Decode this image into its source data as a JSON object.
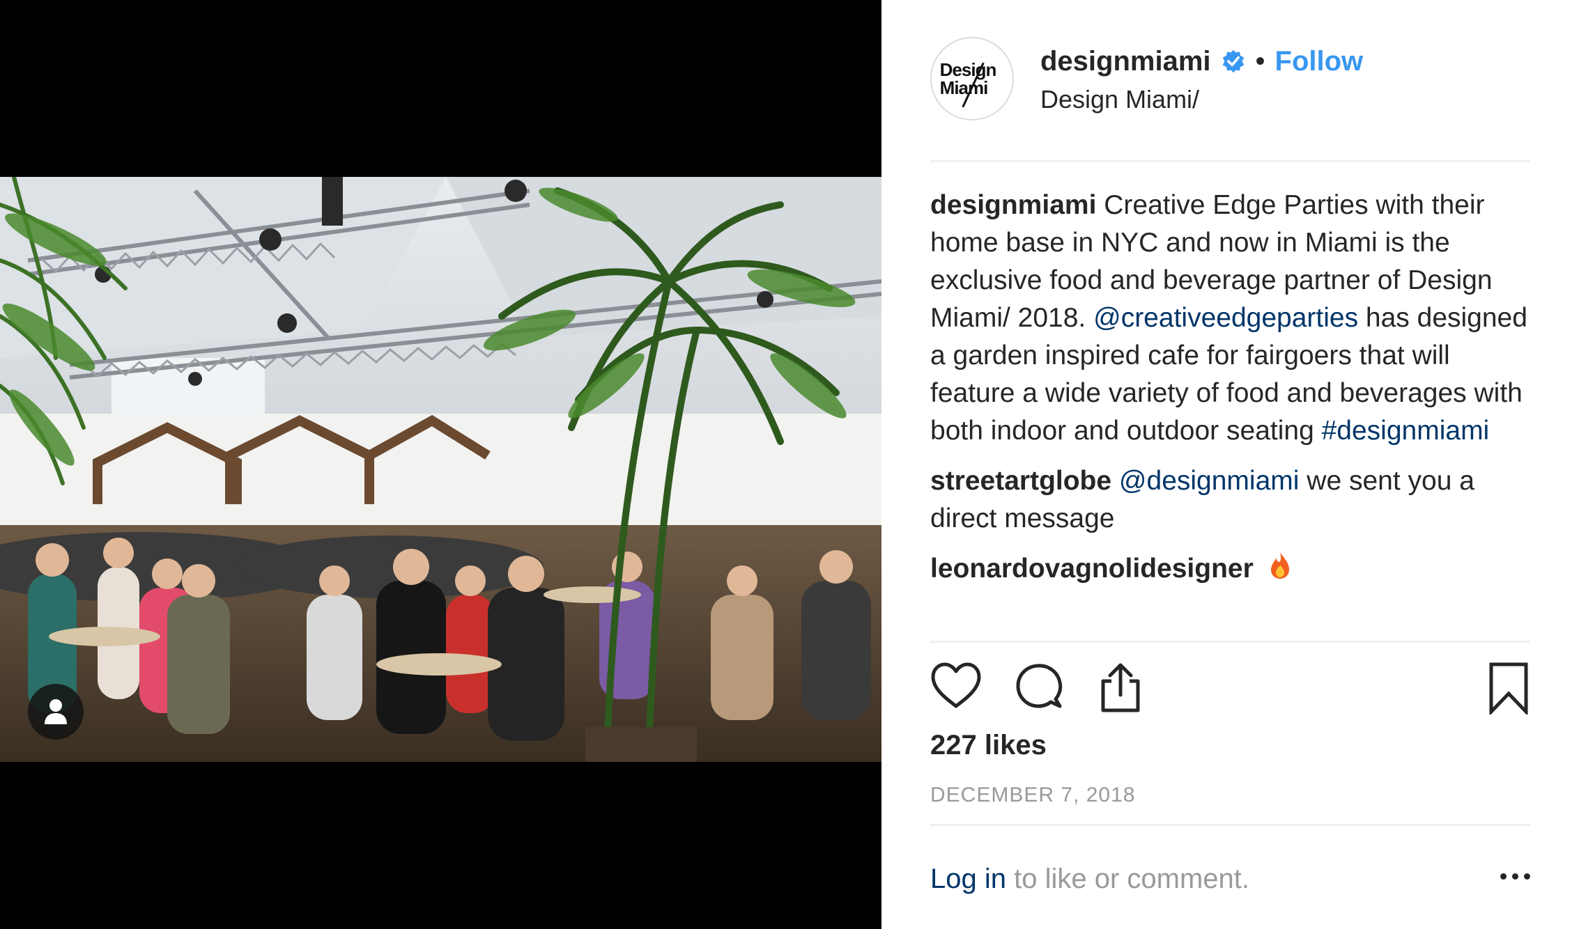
{
  "post": {
    "image_alt": "Creative Edge Parties garden inspired cafe at Design Miami/ 2018",
    "user_tag_icon": "person-icon"
  },
  "header": {
    "avatar_logo_line1": "Design",
    "avatar_logo_line2": "Miami",
    "username": "designmiami",
    "verified_icon": "verified-badge-icon",
    "separator": "•",
    "follow_label": "Follow",
    "subtitle": "Design Miami/"
  },
  "caption": {
    "username": "designmiami",
    "text_part1": " Creative Edge Parties with their home base in NYC and now in Miami is the exclusive food and beverage partner of Design Miami/ 2018. ",
    "mention": "@creativeedgeparties",
    "text_part2": " has designed a garden inspired cafe for fairgoers that will feature a wide variety of food and beverages with both indoor and outdoor seating ",
    "hashtag": "#designmiami"
  },
  "comments": [
    {
      "username": "streetartglobe",
      "mention": "@designmiami",
      "text": " we sent you a direct message"
    },
    {
      "username": "leonardovagnolidesigner",
      "emoji_icon": "fire-icon"
    }
  ],
  "actions": {
    "like_icon": "heart-icon",
    "comment_icon": "comment-icon",
    "share_icon": "share-icon",
    "save_icon": "bookmark-icon"
  },
  "likes_text": "227 likes",
  "date": "DECEMBER 7, 2018",
  "footer": {
    "login_label": "Log in",
    "login_suffix": " to like or comment.",
    "more_icon": "more-options-icon"
  },
  "colors": {
    "link_blue": "#003569",
    "follow_blue": "#3897f0",
    "text": "#262626",
    "muted": "#999999"
  }
}
